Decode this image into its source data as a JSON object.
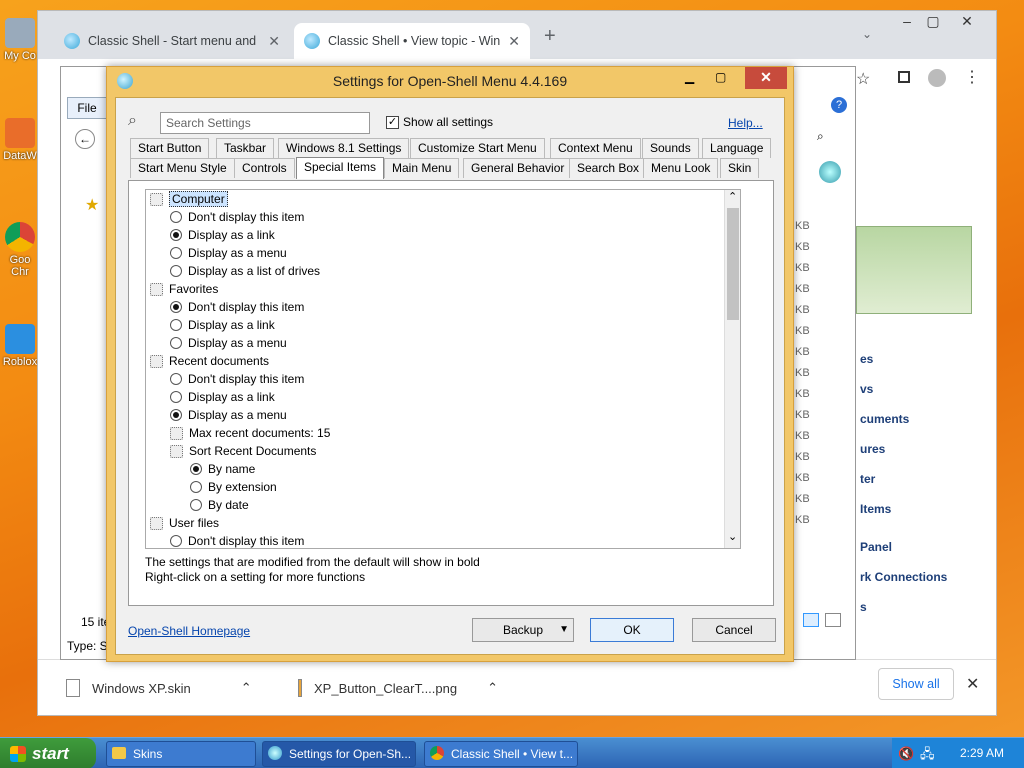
{
  "desktop": {
    "icons": [
      "My Co",
      "DataW",
      "Goo Chr",
      "Roblox"
    ]
  },
  "chrome": {
    "tabs": [
      {
        "title": "Classic Shell - Start menu and ot"
      },
      {
        "title": "Classic Shell • View topic - Wind"
      }
    ],
    "downloads": [
      {
        "name": "Windows XP.skin"
      },
      {
        "name": "XP_Button_ClearT....png"
      }
    ],
    "show_all": "Show all"
  },
  "explorer": {
    "file_menu": "File",
    "item_count": "15 ite",
    "type_label": "Type: S",
    "size_unit": "KB",
    "right_menu": [
      "es",
      "vs",
      "cuments",
      "ures",
      "ter",
      "Items",
      "Panel",
      "rk Connections",
      "s"
    ]
  },
  "dialog": {
    "title": "Settings for Open-Shell Menu 4.4.169",
    "search_placeholder": "Search Settings",
    "show_all_settings": "Show all settings",
    "help": "Help...",
    "tabs_row1": [
      "Start Button",
      "Taskbar",
      "Windows 8.1 Settings",
      "Customize Start Menu",
      "Context Menu",
      "Sounds",
      "Language"
    ],
    "tabs_row2": [
      "Start Menu Style",
      "Controls",
      "Special Items",
      "Main Menu",
      "General Behavior",
      "Search Box",
      "Menu Look",
      "Skin"
    ],
    "active_tab": "Special Items",
    "tree": [
      {
        "label": "Computer",
        "type": "group",
        "indent": 0,
        "selected": true
      },
      {
        "label": "Don't display this item",
        "type": "radio",
        "indent": 1,
        "checked": false
      },
      {
        "label": "Display as a link",
        "type": "radio",
        "indent": 1,
        "checked": true
      },
      {
        "label": "Display as a menu",
        "type": "radio",
        "indent": 1,
        "checked": false
      },
      {
        "label": "Display as a list of drives",
        "type": "radio",
        "indent": 1,
        "checked": false
      },
      {
        "label": "Favorites",
        "type": "group",
        "indent": 0
      },
      {
        "label": "Don't display this item",
        "type": "radio",
        "indent": 1,
        "checked": true
      },
      {
        "label": "Display as a link",
        "type": "radio",
        "indent": 1,
        "checked": false
      },
      {
        "label": "Display as a menu",
        "type": "radio",
        "indent": 1,
        "checked": false
      },
      {
        "label": "Recent documents",
        "type": "group",
        "indent": 0
      },
      {
        "label": "Don't display this item",
        "type": "radio",
        "indent": 1,
        "checked": false
      },
      {
        "label": "Display as a link",
        "type": "radio",
        "indent": 1,
        "checked": false
      },
      {
        "label": "Display as a menu",
        "type": "radio",
        "indent": 1,
        "checked": true
      },
      {
        "label": "Max recent documents: 15",
        "type": "setting",
        "indent": 1
      },
      {
        "label": "Sort Recent Documents",
        "type": "setting",
        "indent": 1
      },
      {
        "label": "By name",
        "type": "radio",
        "indent": 2,
        "checked": true
      },
      {
        "label": "By extension",
        "type": "radio",
        "indent": 2,
        "checked": false
      },
      {
        "label": "By date",
        "type": "radio",
        "indent": 2,
        "checked": false
      },
      {
        "label": "User files",
        "type": "group",
        "indent": 0
      },
      {
        "label": "Don't display this item",
        "type": "radio",
        "indent": 1,
        "checked": false
      }
    ],
    "info_line1": "The settings that are modified from the default will show in bold",
    "info_line2": "Right-click on a setting for more functions",
    "homepage_link": "Open-Shell Homepage",
    "backup": "Backup",
    "ok": "OK",
    "cancel": "Cancel"
  },
  "taskbar": {
    "start": "start",
    "items": [
      "Skins",
      "Settings for Open-Sh...",
      "Classic Shell • View t..."
    ],
    "clock": "2:29 AM"
  }
}
